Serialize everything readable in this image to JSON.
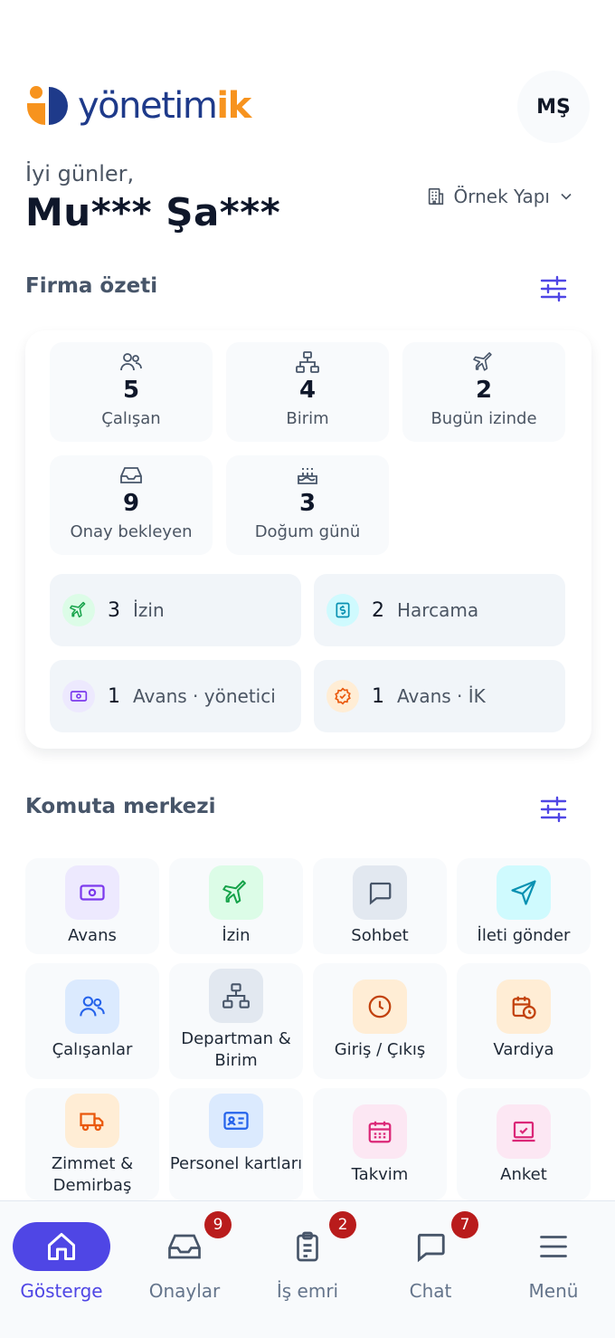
{
  "brand": {
    "logo_text_main": "yönetim",
    "logo_text_accent": "ik"
  },
  "user": {
    "initials": "MŞ",
    "greeting": "İyi günler,",
    "name": "Mu*** Şa***"
  },
  "org": {
    "label": "Örnek Yapı"
  },
  "summary": {
    "title": "Firma özeti",
    "stats": [
      {
        "icon": "users-icon",
        "value": "5",
        "label": "Çalışan"
      },
      {
        "icon": "org-chart-icon",
        "value": "4",
        "label": "Birim"
      },
      {
        "icon": "plane-icon",
        "value": "2",
        "label": "Bugün izinde"
      },
      {
        "icon": "inbox-icon",
        "value": "9",
        "label": "Onay bekleyen"
      },
      {
        "icon": "cake-icon",
        "value": "3",
        "label": "Doğum günü"
      }
    ],
    "pending": [
      {
        "icon": "plane-icon",
        "value": "3",
        "label": "İzin",
        "color": "#16a34a",
        "bg": "#dcfce7"
      },
      {
        "icon": "receipt-icon",
        "value": "2",
        "label": "Harcama",
        "color": "#0891b2",
        "bg": "#cffafe"
      },
      {
        "icon": "cash-icon",
        "value": "1",
        "label": "Avans · yönetici",
        "color": "#7c3aed",
        "bg": "#ede9fe"
      },
      {
        "icon": "badge-check-icon",
        "value": "1",
        "label": "Avans · İK",
        "color": "#ea580c",
        "bg": "#ffedd5"
      }
    ]
  },
  "command": {
    "title": "Komuta merkezi",
    "items": [
      {
        "label": "Avans",
        "icon": "cash-icon",
        "color": "#7c3aed",
        "bg": "#ede9fe"
      },
      {
        "label": "İzin",
        "icon": "plane-icon",
        "color": "#16a34a",
        "bg": "#dcfce7"
      },
      {
        "label": "Sohbet",
        "icon": "chat-icon",
        "color": "#475569",
        "bg": "#e2e8f0"
      },
      {
        "label": "İleti gönder",
        "icon": "send-icon",
        "color": "#0891b2",
        "bg": "#cffafe"
      },
      {
        "label": "Çalışanlar",
        "icon": "users-icon",
        "color": "#2563eb",
        "bg": "#dbeafe"
      },
      {
        "label": "Departman & Birim",
        "icon": "org-chart-icon",
        "color": "#475569",
        "bg": "#e2e8f0"
      },
      {
        "label": "Giriş / Çıkış",
        "icon": "clock-icon",
        "color": "#c2410c",
        "bg": "#ffedd5"
      },
      {
        "label": "Vardiya",
        "icon": "calendar-clock-icon",
        "color": "#c2410c",
        "bg": "#ffedd5"
      },
      {
        "label": "Zimmet & Demirbaş",
        "icon": "truck-icon",
        "color": "#ea580c",
        "bg": "#ffedd5"
      },
      {
        "label": "Personel kartları",
        "icon": "id-card-icon",
        "color": "#2563eb",
        "bg": "#dbeafe"
      },
      {
        "label": "Takvim",
        "icon": "calendar-icon",
        "color": "#db2777",
        "bg": "#fce7f3"
      },
      {
        "label": "Anket",
        "icon": "survey-icon",
        "color": "#db2777",
        "bg": "#fce7f3"
      }
    ]
  },
  "nav": {
    "items": [
      {
        "label": "Gösterge",
        "icon": "home-icon",
        "badge": ""
      },
      {
        "label": "Onaylar",
        "icon": "inbox-icon",
        "badge": "9"
      },
      {
        "label": "İş emri",
        "icon": "clipboard-icon",
        "badge": "2"
      },
      {
        "label": "Chat",
        "icon": "chat-icon",
        "badge": "7"
      },
      {
        "label": "Menü",
        "icon": "menu-icon",
        "badge": ""
      }
    ]
  },
  "colors": {
    "primary": "#4f46e5",
    "badge": "#b91c1c",
    "brand_blue": "#1e3a8a",
    "brand_orange": "#f7931e"
  }
}
